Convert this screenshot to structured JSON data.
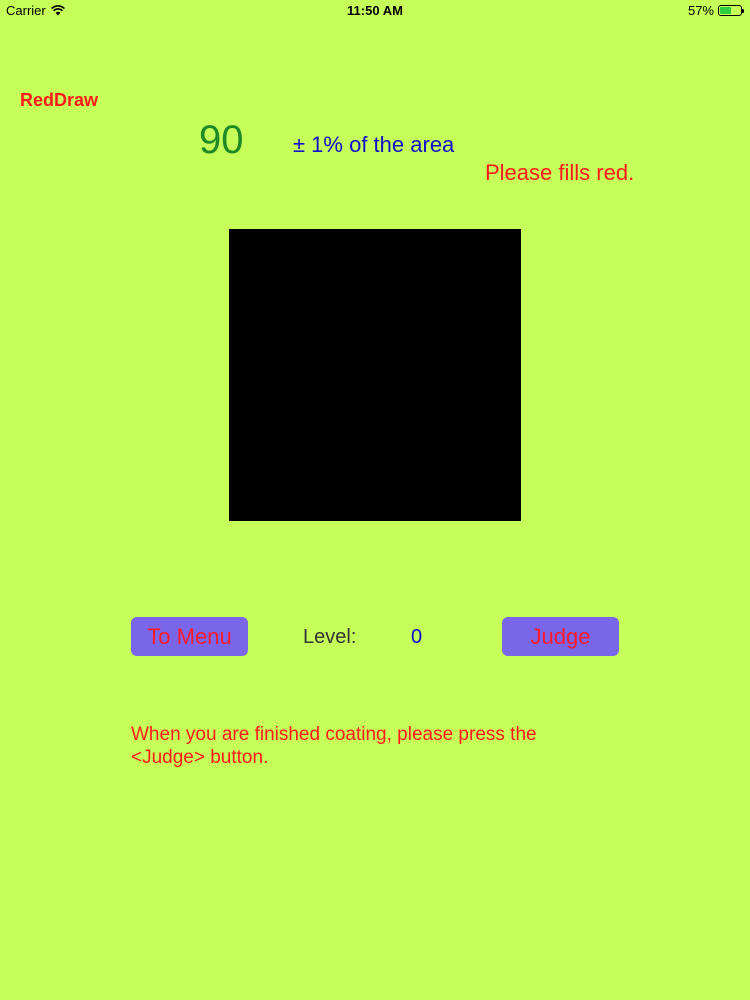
{
  "status_bar": {
    "carrier": "Carrier",
    "time": "11:50 AM",
    "battery_text": "57%",
    "battery_level": 0.57
  },
  "app_title": "RedDraw",
  "target": {
    "number": "90",
    "tolerance": "± 1% of the area",
    "instruction": "Please fills red."
  },
  "controls": {
    "menu_label": "To Menu",
    "level_label": "Level:",
    "level_value": "0",
    "judge_label": "Judge"
  },
  "hint": {
    "line1": "When you are finished coating, please press the",
    "line2": "<Judge> button."
  },
  "colors": {
    "background": "#c6ff5a",
    "title_red": "#ff1a1a",
    "button_bg": "#7a66e8",
    "number_green": "#1e8a26",
    "accent_blue": "#1010c8",
    "canvas": "#000000"
  }
}
